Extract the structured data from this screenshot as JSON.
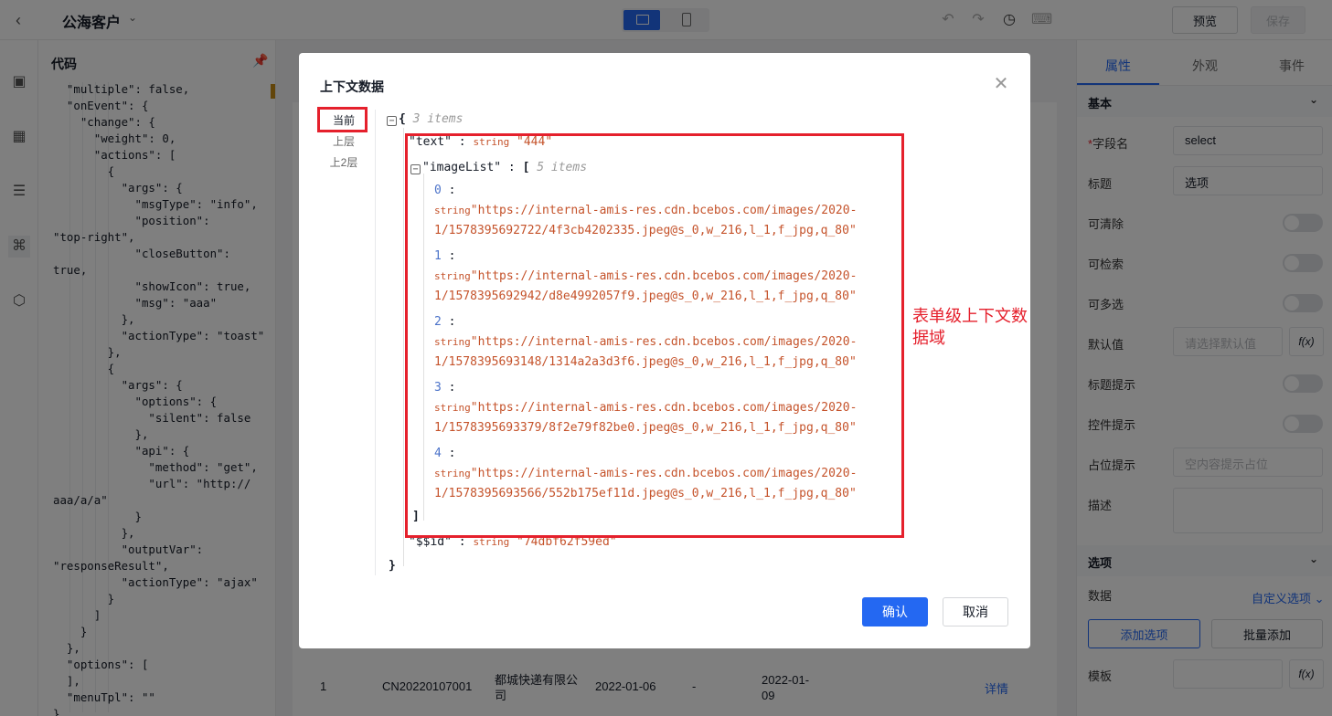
{
  "header": {
    "back_icon": "chevron-left-icon",
    "title": "公海客户",
    "preview_label": "预览",
    "save_label": "保存"
  },
  "code_panel": {
    "title": "代码",
    "lines": [
      "  \"multiple\": false,",
      "  \"onEvent\": {",
      "    \"change\": {",
      "      \"weight\": 0,",
      "      \"actions\": [",
      "        {",
      "          \"args\": {",
      "            \"msgType\": \"info\",",
      "            \"position\":",
      "\"top-right\",",
      "            \"closeButton\":",
      "true,",
      "            \"showIcon\": true,",
      "            \"msg\": \"aaa\"",
      "          },",
      "          \"actionType\": \"toast\"",
      "        },",
      "        {",
      "          \"args\": {",
      "            \"options\": {",
      "              \"silent\": false",
      "            },",
      "            \"api\": {",
      "              \"method\": \"get\",",
      "              \"url\": \"http://",
      "aaa/a/a\"",
      "            }",
      "          },",
      "          \"outputVar\":",
      "\"responseResult\",",
      "          \"actionType\": \"ajax\"",
      "        }",
      "      ]",
      "    }",
      "  },",
      "  \"options\": [",
      "  ],",
      "  \"menuTpl\": \"\"",
      "}"
    ]
  },
  "right_panel": {
    "tabs": [
      "属性",
      "外观",
      "事件"
    ],
    "section_basic": "基本",
    "field_name_label": "字段名",
    "field_name_value": "select",
    "title_label": "标题",
    "title_value": "选项",
    "clearable_label": "可清除",
    "searchable_label": "可检索",
    "multiple_label": "可多选",
    "default_label": "默认值",
    "default_placeholder": "请选择默认值",
    "fx_label": "f(x)",
    "title_tip_label": "标题提示",
    "control_tip_label": "控件提示",
    "placeholder_label": "占位提示",
    "placeholder_placeholder": "空内容提示占位",
    "desc_label": "描述",
    "section_options": "选项",
    "data_label": "数据",
    "custom_options_link": "自定义选项",
    "add_option_button": "添加选项",
    "batch_add_button": "批量添加",
    "template_label": "模板"
  },
  "table_row": {
    "index": "1",
    "order_no": "CN20220107001",
    "company_line1": "都城快递有限公",
    "company_line2": "司",
    "date1": "2022-01-06",
    "dash": "-",
    "date2_line1": "2022-01-",
    "date2_line2": "09",
    "detail_link": "详情"
  },
  "modal": {
    "title": "上下文数据",
    "scopes": [
      "当前",
      "上层",
      "上2层"
    ],
    "root_meta": "3 items",
    "text_key": "\"text\"",
    "text_value": "\"444\"",
    "type_string": "string",
    "image_list_key": "\"imageList\"",
    "image_list_meta": "5 items",
    "images": [
      {
        "index": "0",
        "line1": "\"https://internal-amis-res.cdn.bcebos.com/images/2020-",
        "line2": "1/1578395692722/4f3cb4202335.jpeg@s_0,w_216,l_1,f_jpg,q_80\""
      },
      {
        "index": "1",
        "line1": "\"https://internal-amis-res.cdn.bcebos.com/images/2020-",
        "line2": "1/1578395692942/d8e4992057f9.jpeg@s_0,w_216,l_1,f_jpg,q_80\""
      },
      {
        "index": "2",
        "line1": "\"https://internal-amis-res.cdn.bcebos.com/images/2020-",
        "line2": "1/1578395693148/1314a2a3d3f6.jpeg@s_0,w_216,l_1,f_jpg,q_80\""
      },
      {
        "index": "3",
        "line1": "\"https://internal-amis-res.cdn.bcebos.com/images/2020-",
        "line2": "1/1578395693379/8f2e79f82be0.jpeg@s_0,w_216,l_1,f_jpg,q_80\""
      },
      {
        "index": "4",
        "line1": "\"https://internal-amis-res.cdn.bcebos.com/images/2020-",
        "line2": "1/1578395693566/552b175ef11d.jpeg@s_0,w_216,l_1,f_jpg,q_80\""
      }
    ],
    "id_key": "\"$$id\"",
    "id_value": "\"74dbf62f59ed\"",
    "annotation": "表单级上下文数据域",
    "confirm_label": "确认",
    "cancel_label": "取消"
  },
  "colors": {
    "primary": "#2468f2",
    "highlight_red": "#e5202c",
    "string_value": "#c5532b"
  }
}
